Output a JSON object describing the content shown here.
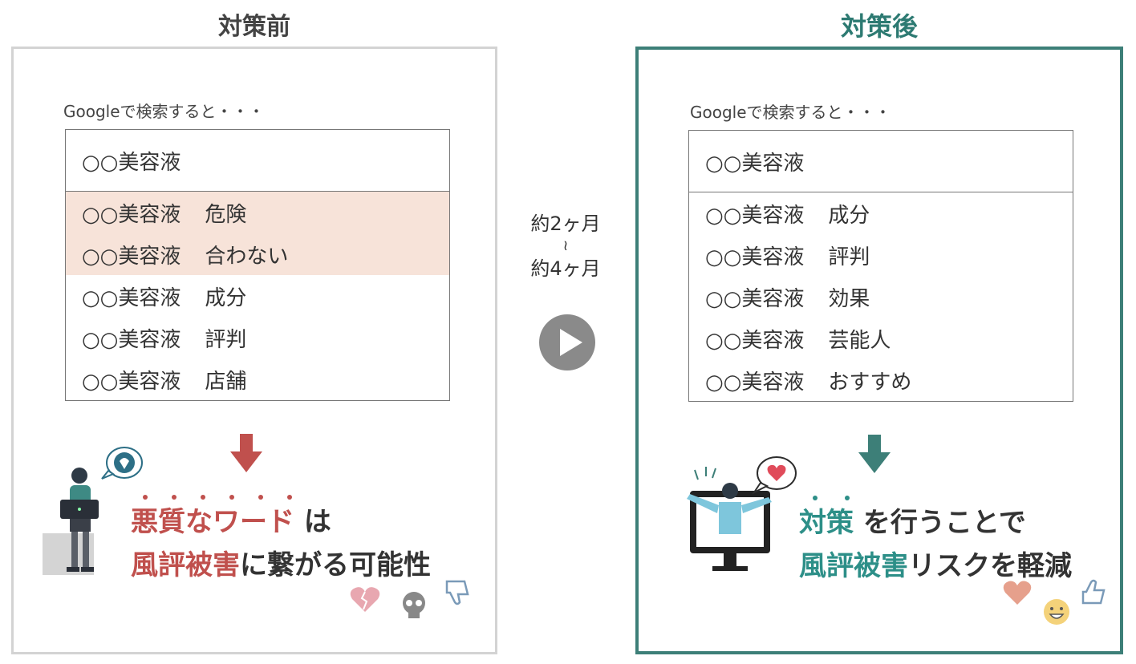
{
  "before": {
    "heading": "対策前",
    "intro": "Googleで検索すると・・・",
    "query": "○○美容液",
    "suggestions": [
      {
        "base": "○○美容液",
        "keyword": "危険",
        "highlight": true
      },
      {
        "base": "○○美容液",
        "keyword": "合わない",
        "highlight": true
      },
      {
        "base": "○○美容液",
        "keyword": "成分",
        "highlight": false
      },
      {
        "base": "○○美容液",
        "keyword": "評判",
        "highlight": false
      },
      {
        "base": "○○美容液",
        "keyword": "店舗",
        "highlight": false
      }
    ],
    "message": {
      "line1_emph": "悪質なワード",
      "line1_rest": "は",
      "line2_emph": "風評被害",
      "line2_rest": "に繋がる可能性"
    }
  },
  "middle": {
    "line1": "約2ヶ月",
    "tilde": "≀",
    "line2": "約4ヶ月"
  },
  "after": {
    "heading": "対策後",
    "intro": "Googleで検索すると・・・",
    "query": "○○美容液",
    "suggestions": [
      {
        "base": "○○美容液",
        "keyword": "成分",
        "highlight": false
      },
      {
        "base": "○○美容液",
        "keyword": "評判",
        "highlight": false
      },
      {
        "base": "○○美容液",
        "keyword": "効果",
        "highlight": false
      },
      {
        "base": "○○美容液",
        "keyword": "芸能人",
        "highlight": false
      },
      {
        "base": "○○美容液",
        "keyword": "おすすめ",
        "highlight": false
      }
    ],
    "message": {
      "line1_emph": "対策",
      "line1_rest": "を行うことで",
      "line2_emph": "風評被害",
      "line2_rest": "リスクを軽減"
    }
  },
  "colors": {
    "negative": "#c0504d",
    "positive": "#2d8f88",
    "highlight": "#f7e3d9"
  }
}
